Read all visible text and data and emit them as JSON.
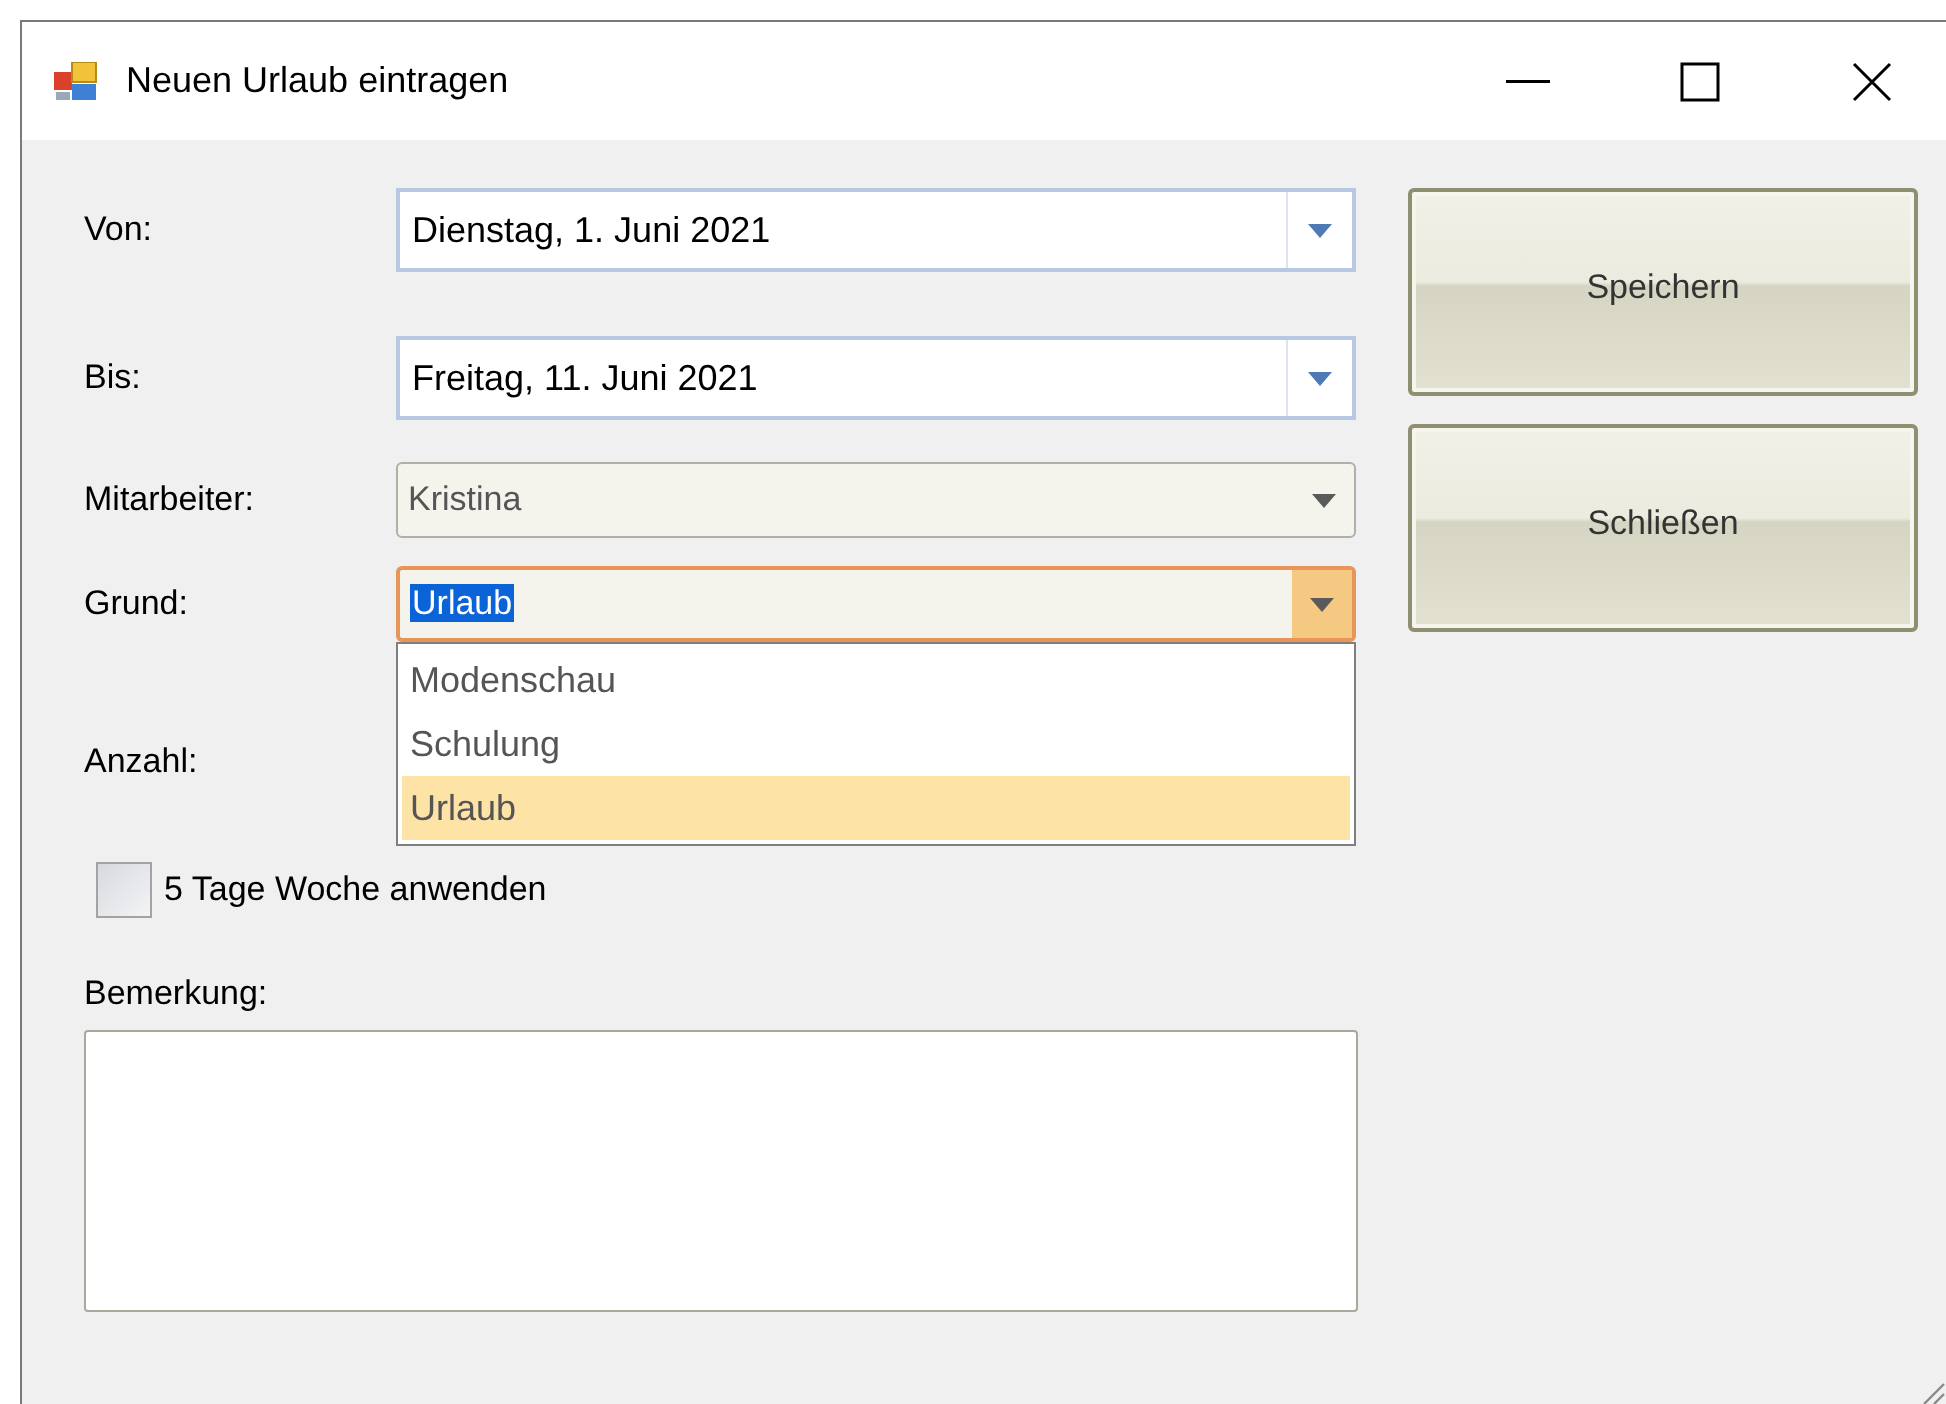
{
  "window": {
    "title": "Neuen Urlaub eintragen"
  },
  "fields": [
    {
      "label": "Von:",
      "kind": "date",
      "value": "Dienstag, 1. Juni 2021"
    },
    {
      "label": "Bis:",
      "kind": "date",
      "value": "Freitag, 11. Juni 2021"
    },
    {
      "label": "Mitarbeiter:",
      "kind": "combo",
      "value": "Kristina",
      "focused": false
    },
    {
      "label": "Grund:",
      "kind": "combo",
      "value": "Urlaub",
      "focused": true,
      "options": [
        {
          "label": "Modenschau",
          "selected": false
        },
        {
          "label": "Schulung",
          "selected": false
        },
        {
          "label": "Urlaub",
          "selected": true
        }
      ]
    },
    {
      "label": "Anzahl:",
      "kind": "covered"
    }
  ],
  "checkbox": {
    "label": "5 Tage Woche anwenden",
    "checked": false
  },
  "remark": {
    "label": "Bemerkung:"
  },
  "buttons": [
    "Speichern",
    "Schließen"
  ]
}
